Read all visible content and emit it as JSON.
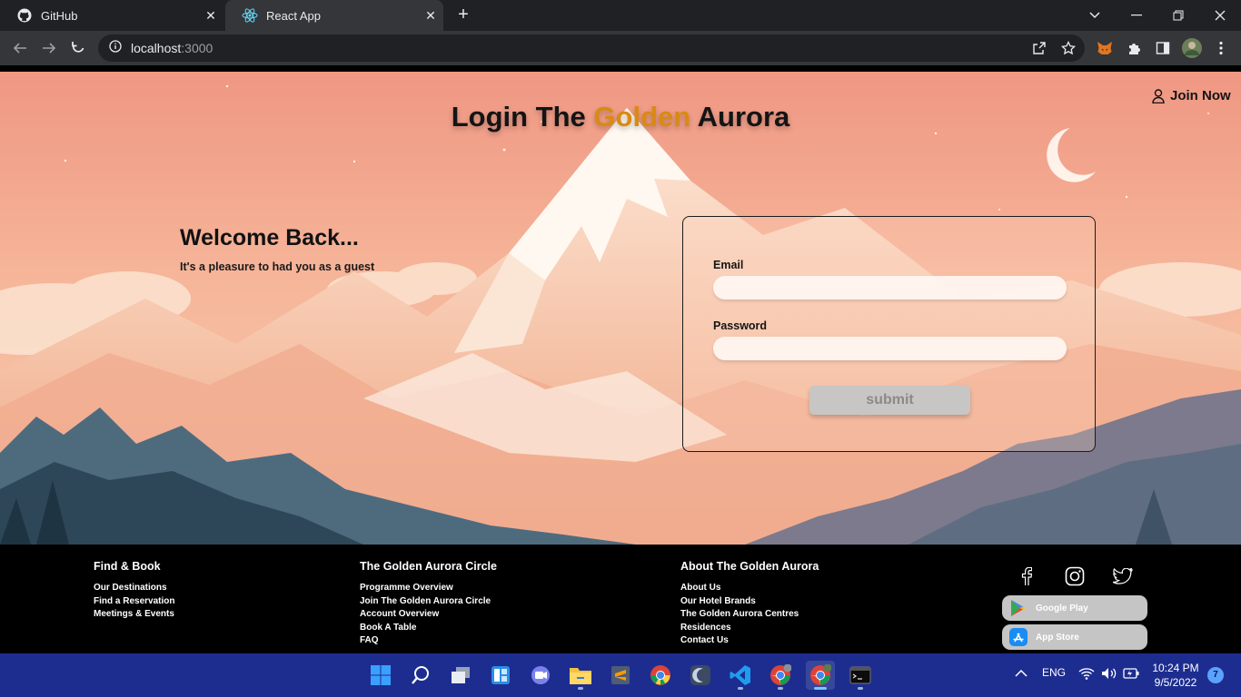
{
  "browser": {
    "tabs": [
      {
        "title": "GitHub",
        "icon": "github-icon",
        "active": false
      },
      {
        "title": "React App",
        "icon": "react-icon",
        "active": true
      }
    ],
    "url_host": "localhost",
    "url_port": ":3000"
  },
  "page": {
    "title_part1": "Login The ",
    "title_gold": "Golden",
    "title_part2": " Aurora",
    "join_now": "Join Now",
    "welcome_title": "Welcome Back...",
    "welcome_subtitle": "It's a pleasure to had you as a guest",
    "form": {
      "email_label": "Email",
      "email_value": "",
      "password_label": "Password",
      "password_value": "",
      "submit_label": "submit"
    },
    "colors": {
      "gold": "#d98a12",
      "sky": "#f19a84"
    }
  },
  "footer": {
    "columns": [
      {
        "title": "Find & Book",
        "links": [
          "Our Destinations",
          "Find a Reservation",
          "Meetings & Events"
        ]
      },
      {
        "title": "The Golden Aurora Circle",
        "links": [
          "Programme Overview",
          "Join The Golden Aurora Circle",
          "Account Overview",
          "Book A Table",
          "FAQ"
        ]
      },
      {
        "title": "About The Golden Aurora",
        "links": [
          "About Us",
          "Our Hotel Brands",
          "The Golden Aurora Centres",
          "Residences",
          "Contact Us"
        ]
      }
    ],
    "social": [
      "facebook-icon",
      "instagram-icon",
      "twitter-icon"
    ],
    "stores": [
      {
        "label": "Google Play",
        "icon": "google-play-icon"
      },
      {
        "label": "App Store",
        "icon": "app-store-icon"
      }
    ]
  },
  "taskbar": {
    "language": "ENG",
    "time": "10:24 PM",
    "date": "9/5/2022",
    "notifications": "7"
  }
}
